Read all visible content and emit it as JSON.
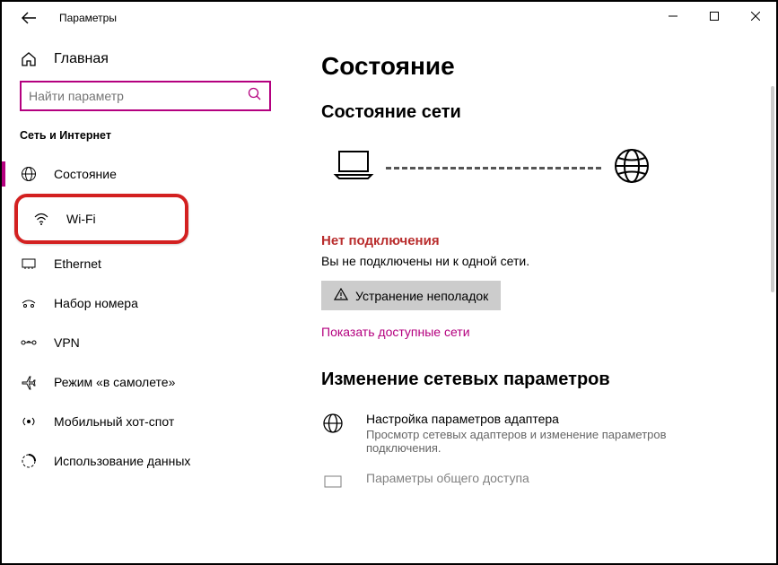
{
  "titlebar": {
    "app_title": "Параметры"
  },
  "sidebar": {
    "home_label": "Главная",
    "search_placeholder": "Найти параметр",
    "section_title": "Сеть и Интернет",
    "items": [
      {
        "label": "Состояние"
      },
      {
        "label": "Wi-Fi"
      },
      {
        "label": "Ethernet"
      },
      {
        "label": "Набор номера"
      },
      {
        "label": "VPN"
      },
      {
        "label": "Режим «в самолете»"
      },
      {
        "label": "Мобильный хот-спот"
      },
      {
        "label": "Использование данных"
      }
    ]
  },
  "main": {
    "page_title": "Состояние",
    "network_status_heading": "Состояние сети",
    "no_connection_label": "Нет подключения",
    "no_connection_text": "Вы не подключены ни к одной сети.",
    "troubleshoot_button": "Устранение неполадок",
    "show_networks_link": "Показать доступные сети",
    "change_settings_heading": "Изменение сетевых параметров",
    "adapter_title": "Настройка параметров адаптера",
    "adapter_desc": "Просмотр сетевых адаптеров и изменение параметров подключения.",
    "sharing_title": "Параметры общего доступа"
  }
}
